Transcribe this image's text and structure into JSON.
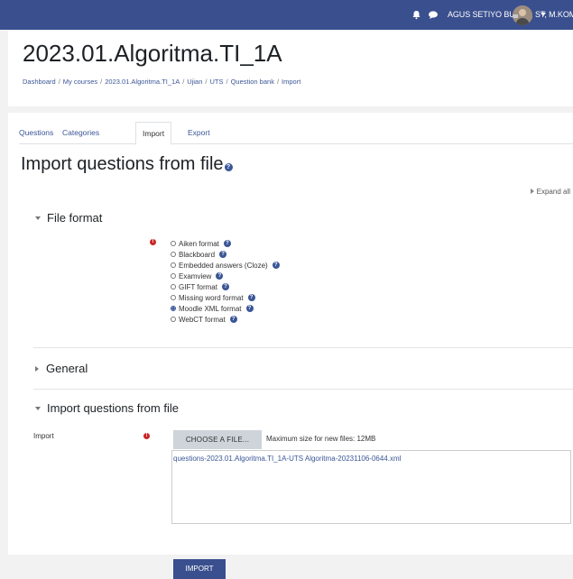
{
  "topbar": {
    "user_name": "AGUS SETIYO BUDI N, ST, M.KOM",
    "icons": [
      "bell-icon",
      "chat-icon",
      "avatar",
      "caret-down-icon"
    ]
  },
  "header": {
    "course_title": "2023.01.Algoritma.TI_1A",
    "breadcrumb": [
      "Dashboard",
      "My courses",
      "2023.01.Algoritma.TI_1A",
      "Ujian",
      "UTS",
      "Question bank",
      "Import"
    ]
  },
  "tabs": [
    "Questions",
    "Categories",
    "Import",
    "Export"
  ],
  "page_title": "Import questions from file",
  "expand_all": "Expand all",
  "sections": {
    "file_format": "File format",
    "general": "General",
    "import_from_file": "Import questions from file"
  },
  "formats": [
    {
      "label": "Aiken format",
      "selected": false
    },
    {
      "label": "Blackboard",
      "selected": false
    },
    {
      "label": "Embedded answers (Cloze)",
      "selected": false
    },
    {
      "label": "Examview",
      "selected": false
    },
    {
      "label": "GIFT format",
      "selected": false
    },
    {
      "label": "Missing word format",
      "selected": false
    },
    {
      "label": "Moodle XML format",
      "selected": true
    },
    {
      "label": "WebCT format",
      "selected": false
    }
  ],
  "import_field": {
    "label": "Import",
    "choose_button": "CHOOSE A FILE...",
    "max_size": "Maximum size for new files: 12MB",
    "file_name": "questions-2023.01.Algoritma.TI_1A-UTS Algoritma-20231106-0644.xml",
    "import_button": "IMPORT"
  },
  "colors": {
    "topbar": "#3a4f8e",
    "link": "#3a5696",
    "required": "#c92626"
  }
}
